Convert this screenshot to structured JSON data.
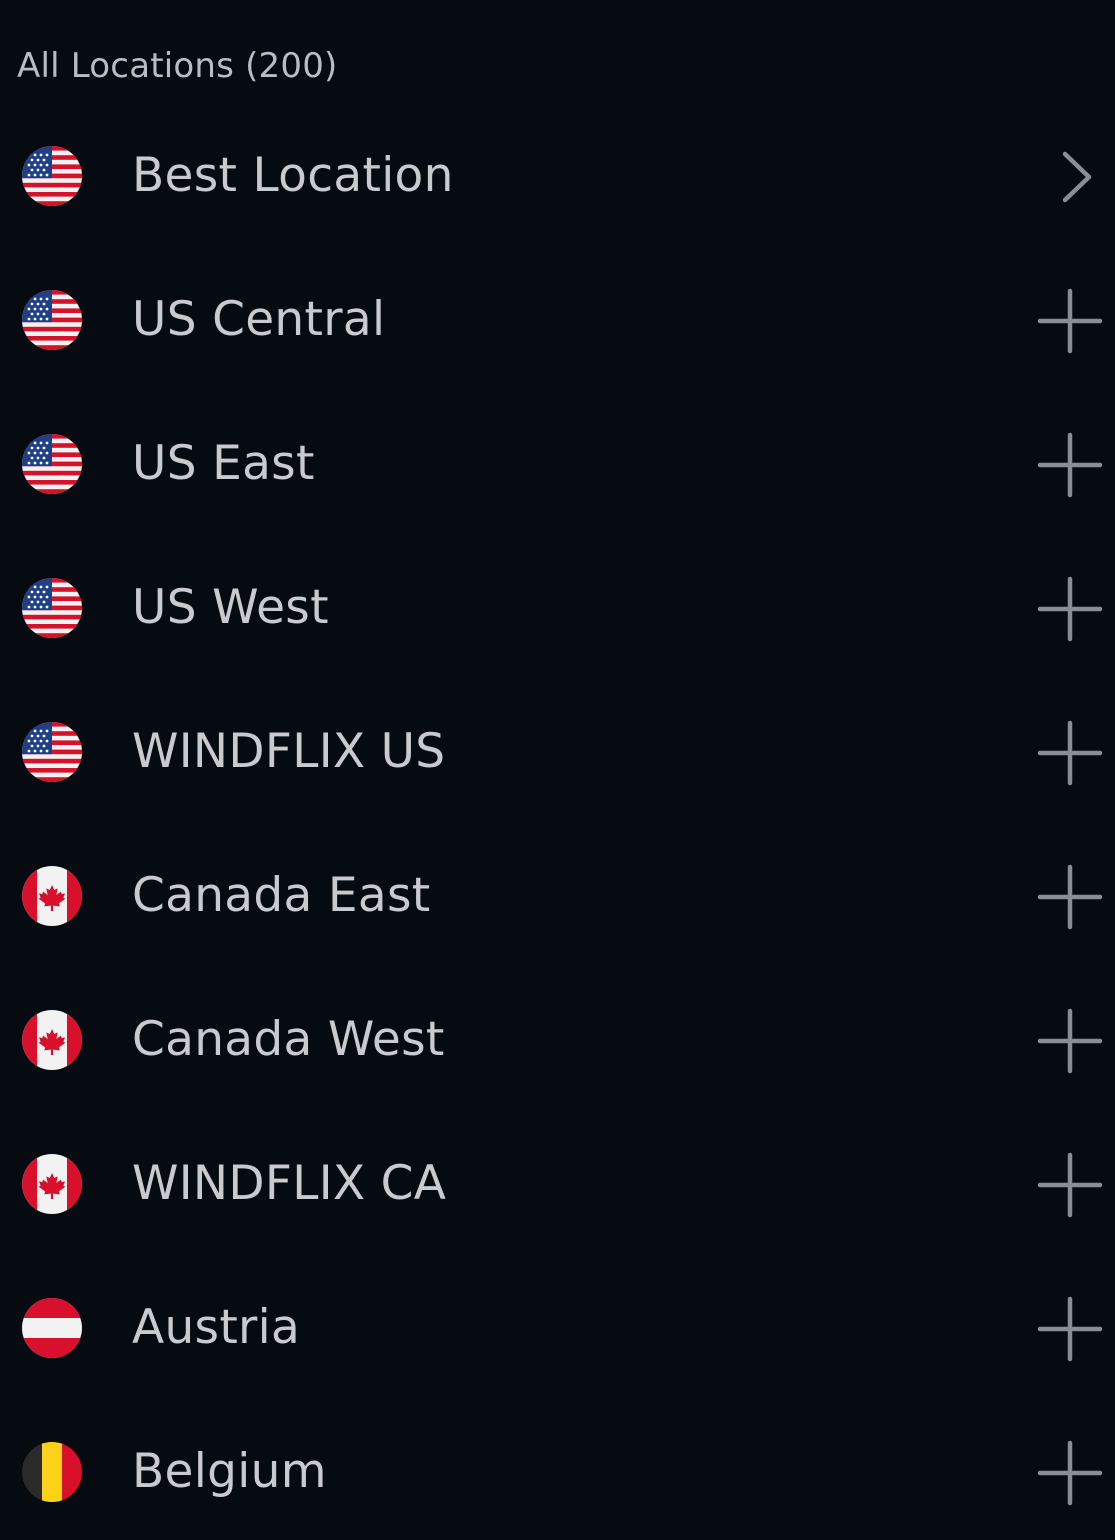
{
  "header": {
    "title": "All Locations (200)"
  },
  "colors": {
    "background": "#060a11",
    "text": "#c8cace",
    "header_text": "#b9bcc1",
    "icon": "#8a8d92"
  },
  "locations": [
    {
      "label": "Best Location",
      "flag": "us-flag-icon",
      "action": "chevron-right-icon"
    },
    {
      "label": "US Central",
      "flag": "us-flag-icon",
      "action": "plus-icon"
    },
    {
      "label": "US East",
      "flag": "us-flag-icon",
      "action": "plus-icon"
    },
    {
      "label": "US West",
      "flag": "us-flag-icon",
      "action": "plus-icon"
    },
    {
      "label": "WINDFLIX US",
      "flag": "us-flag-icon",
      "action": "plus-icon"
    },
    {
      "label": "Canada East",
      "flag": "canada-flag-icon",
      "action": "plus-icon"
    },
    {
      "label": "Canada West",
      "flag": "canada-flag-icon",
      "action": "plus-icon"
    },
    {
      "label": "WINDFLIX CA",
      "flag": "canada-flag-icon",
      "action": "plus-icon"
    },
    {
      "label": "Austria",
      "flag": "austria-flag-icon",
      "action": "plus-icon"
    },
    {
      "label": "Belgium",
      "flag": "belgium-flag-icon",
      "action": "plus-icon"
    }
  ]
}
